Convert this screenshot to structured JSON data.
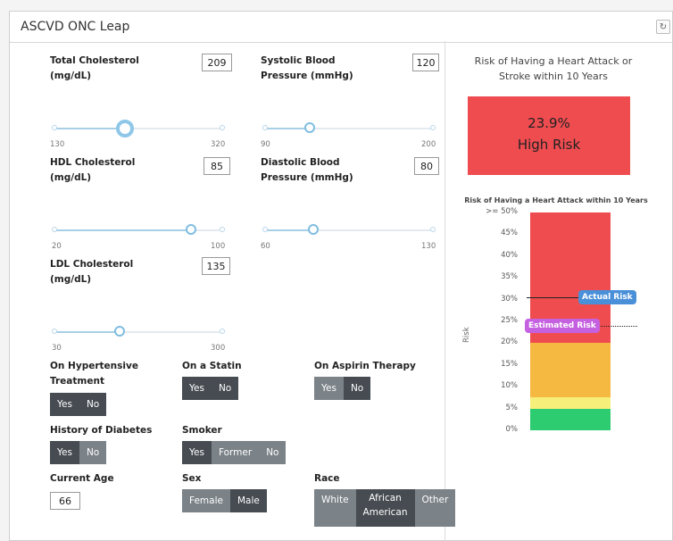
{
  "app": {
    "title": "ASCVD ONC Leap",
    "refresh_icon": "refresh-icon"
  },
  "left": {
    "total_chol": {
      "label_line1": "Total Cholesterol",
      "label_line2": "(mg/dL)",
      "value": "209",
      "min": "130",
      "max": "320",
      "fraction": 0.42
    },
    "systolic": {
      "label_line1": "Systolic Blood",
      "label_line2": "Pressure (mmHg)",
      "value": "120",
      "min": "90",
      "max": "200",
      "fraction": 0.27
    },
    "hdl": {
      "label_line1": "HDL Cholesterol",
      "label_line2": "(mg/dL)",
      "value": "85",
      "min": "20",
      "max": "100",
      "fraction": 0.81
    },
    "diastolic": {
      "label_line1": "Diastolic Blood",
      "label_line2": "Pressure (mmHg)",
      "value": "80",
      "min": "60",
      "max": "130",
      "fraction": 0.29
    },
    "ldl": {
      "label_line1": "LDL Cholesterol",
      "label_line2": "(mg/dL)",
      "value": "135",
      "min": "30",
      "max": "300",
      "fraction": 0.39
    },
    "hypertensive": {
      "label_line1": "On Hypertensive",
      "label_line2": "Treatment",
      "yes": "Yes",
      "no": "No",
      "selected": "Yes"
    },
    "statin": {
      "label": "On a Statin",
      "yes": "Yes",
      "no": "No",
      "selected": "Yes"
    },
    "aspirin": {
      "label": "On Aspirin Therapy",
      "yes": "Yes",
      "no": "No",
      "selected": "none"
    },
    "diabetes": {
      "label": "History of Diabetes",
      "yes": "Yes",
      "no": "No",
      "selected": "Yes"
    },
    "smoker": {
      "label": "Smoker",
      "yes": "Yes",
      "former": "Former",
      "no": "No",
      "selected": "Yes"
    },
    "age": {
      "label": "Current Age",
      "value": "66"
    },
    "sex": {
      "label": "Sex",
      "female": "Female",
      "male": "Male",
      "selected": "none"
    },
    "race": {
      "label": "Race",
      "white": "White",
      "african_l1": "African",
      "african_l2": "American",
      "other": "Other",
      "selected": "African American"
    }
  },
  "right": {
    "title_line1": "Risk of Having a Heart Attack or",
    "title_line2": "Stroke within 10 Years",
    "risk_percent": "23.9%",
    "risk_label": "High Risk",
    "risk_color": "#ef4c50",
    "chart_data": {
      "type": "bar",
      "title": "Risk of Having a Heart Attack within 10 Years",
      "ylabel": "Risk",
      "ylim": [
        0,
        50
      ],
      "ticks": [
        "0%",
        "5%",
        "10%",
        "15%",
        "20%",
        "25%",
        "30%",
        "35%",
        "40%",
        "45%",
        ">= 50%"
      ],
      "bands": [
        {
          "from": 0,
          "to": 5,
          "color": "#2ecc71"
        },
        {
          "from": 5,
          "to": 7.5,
          "color": "#f6ef7a"
        },
        {
          "from": 7.5,
          "to": 20,
          "color": "#f5b841"
        },
        {
          "from": 20,
          "to": 50,
          "color": "#ef4c50"
        }
      ],
      "markers": [
        {
          "name": "Actual Risk",
          "value": 30.5,
          "color": "#4a90d9",
          "style": "solid"
        },
        {
          "name": "Estimated Risk",
          "value": 23.9,
          "color": "#c561e0",
          "style": "dotted"
        }
      ]
    }
  }
}
